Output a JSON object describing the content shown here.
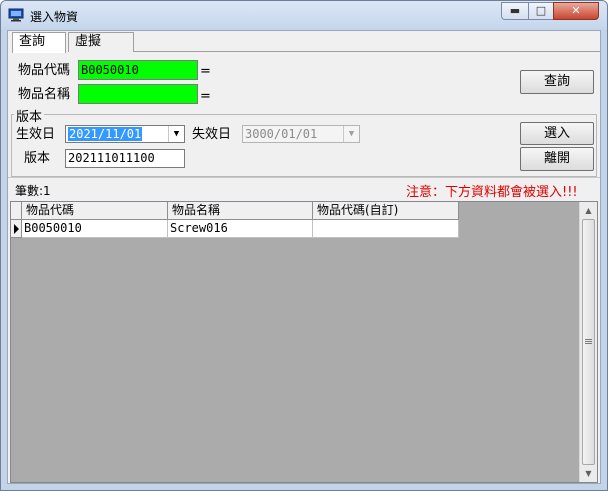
{
  "window": {
    "title": "選入物資",
    "controls": {
      "minimize": "▬",
      "maximize": "□",
      "close": "✕"
    }
  },
  "tabs": [
    {
      "label": "查詢",
      "active": true
    },
    {
      "label": "虛擬",
      "active": false
    }
  ],
  "query": {
    "item_code_label": "物品代碼",
    "item_code_value": "B0050010",
    "item_name_label": "物品名稱",
    "item_name_value": "",
    "operator": "=",
    "search_button": "查詢"
  },
  "version": {
    "group_label": "版本",
    "effective_date_label": "生效日",
    "effective_date_value": "2021/11/01",
    "expiry_date_label": "失效日",
    "expiry_date_value": "3000/01/01",
    "version_label": "版本",
    "version_value": "202111011100"
  },
  "actions": {
    "select_button": "選入",
    "exit_button": "離開"
  },
  "status": {
    "count_label": "筆數:1",
    "warning": "注意：下方資料都會被選入!!!"
  },
  "grid": {
    "columns": [
      "物品代碼",
      "物品名稱",
      "物品代碼(自訂)"
    ],
    "rows": [
      [
        "B0050010",
        "Screw016",
        ""
      ]
    ]
  },
  "colors": {
    "required_field": "#00ff00",
    "warning_text": "#e00000",
    "selection": "#3399ff"
  },
  "icons": {
    "app": "computer-icon",
    "dropdown": "chevron-down-icon",
    "row_pointer": "triangle-right-icon"
  }
}
